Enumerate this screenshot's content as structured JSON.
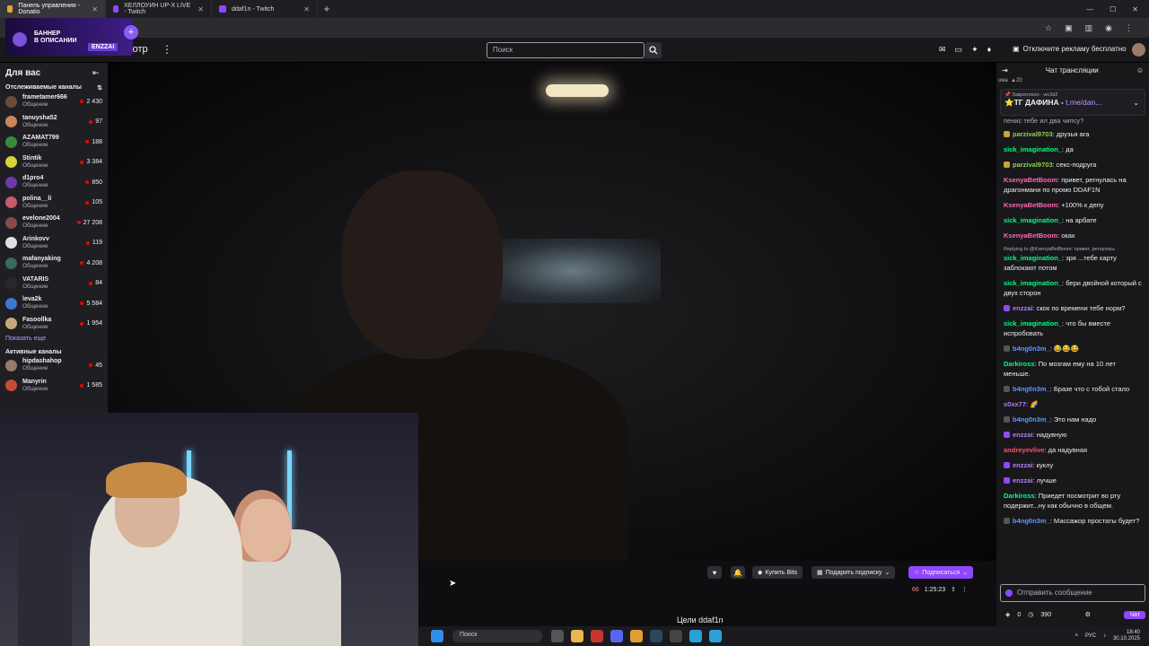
{
  "browser": {
    "tabs": [
      {
        "label": "Панель управления - Donatio",
        "color": "#e6a33a",
        "active": true
      },
      {
        "label": "ХЕЛЛОУИН UP-X LIVE - Twitch",
        "color": "#9147ff",
        "active": false
      },
      {
        "label": "ddaf1n - Twitch",
        "color": "#9147ff",
        "active": false
      }
    ],
    "new_tab": "+"
  },
  "banner": {
    "line1": "БАННЕР",
    "line2": "В ОПИСАНИИ",
    "tag": "ENZZAI"
  },
  "topnav": {
    "browse": "мотр",
    "search_placeholder": "Поиск",
    "adfree": "Отключите рекламу бесплатно"
  },
  "sidebar": {
    "title": "Для вас",
    "followed_title": "Отслеживаемые каналы",
    "followed": [
      {
        "name": "frametamer666",
        "game": "Общение",
        "viewers": "2 430",
        "color": "#6b4a3a"
      },
      {
        "name": "tanuysha52",
        "game": "Общение",
        "viewers": "97",
        "color": "#c8865a"
      },
      {
        "name": "AZAMAT799",
        "game": "Общение",
        "viewers": "188",
        "color": "#3a8a3a"
      },
      {
        "name": "Stintik",
        "game": "Общение",
        "viewers": "3 384",
        "color": "#d8d23a"
      },
      {
        "name": "d1pro4",
        "game": "Общение",
        "viewers": "850",
        "color": "#6a3aa8"
      },
      {
        "name": "polina__li",
        "game": "Общение",
        "viewers": "105",
        "color": "#c85a6a"
      },
      {
        "name": "evelone2004",
        "game": "Общение",
        "viewers": "27 208",
        "color": "#8a4a4a"
      },
      {
        "name": "Arinkovv",
        "game": "Общение",
        "viewers": "119",
        "color": "#e0e0e0"
      },
      {
        "name": "mafanyaking",
        "game": "Общение",
        "viewers": "4 208",
        "color": "#3a6a5a"
      },
      {
        "name": "VATARIS",
        "game": "Общение",
        "viewers": "84",
        "color": "#2a2a2a"
      },
      {
        "name": "leva2k",
        "game": "Общение",
        "viewers": "5 584",
        "color": "#3a7ac8"
      },
      {
        "name": "Fasoollka",
        "game": "Общение",
        "viewers": "1 954",
        "color": "#c8a87a"
      }
    ],
    "show_more": "Показать еще",
    "active_title": "Активные каналы",
    "active": [
      {
        "name": "hipdashahop",
        "game": "Общение",
        "viewers": "45",
        "color": "#9a7a6a"
      },
      {
        "name": "Manyrin",
        "game": "Общение",
        "viewers": "1 585",
        "color": "#c84a3a"
      }
    ]
  },
  "player": {
    "buy_bits": "Купить Bits",
    "gift_sub": "Подарить подписку",
    "subscribe": "Подписаться",
    "viewers": "66",
    "uptime": "1:25:23",
    "goals": "Цели ddaf1n"
  },
  "chat": {
    "title": "Чат трансляции",
    "sub_label": "ома",
    "sub_count": "20",
    "pinned_label": "Закреплено",
    "pinned_by": "wc3d2",
    "pinned_text": "ТГ ДАФИНА - ",
    "pinned_link": "t.me/dan...",
    "top_fragment": "пенис тебе ил два чипсу?",
    "messages": [
      {
        "user": "parzival9703",
        "color": "#8bd24a",
        "text": "друзья ага",
        "badge": "#c8a23a"
      },
      {
        "user": "sick_imagination_",
        "color": "#00ff7f",
        "text": "да",
        "badge": ""
      },
      {
        "user": "parzival9703",
        "color": "#8bd24a",
        "text": "секс-подруга",
        "badge": "#c8a23a"
      },
      {
        "user": "KsenyaBetBoom",
        "color": "#ff69b4",
        "text": "привет, регнулась на драгонмани по промо DDAF1N",
        "badge": ""
      },
      {
        "user": "KsenyaBetBoom",
        "color": "#ff69b4",
        "text": "+100% к депу",
        "badge": ""
      },
      {
        "user": "sick_imagination_",
        "color": "#00ff7f",
        "text": "на арбате",
        "badge": ""
      },
      {
        "user": "KsenyaBetBoom",
        "color": "#ff69b4",
        "text": "окак",
        "badge": ""
      },
      {
        "reply": "Replying to @KsenyaBetBoom: привет, регнулась",
        "user": "sick_imagination_",
        "color": "#00ff7f",
        "text": "зря ...тебе карту заблокают потом",
        "badge": ""
      },
      {
        "user": "sick_imagination_",
        "color": "#00ff7f",
        "text": "бери двойной который с двух сторон",
        "badge": ""
      },
      {
        "user": "enzzai",
        "color": "#b07cff",
        "text": "скок по времени тебе норм?",
        "badge": "#9147ff"
      },
      {
        "user": "sick_imagination_",
        "color": "#00ff7f",
        "text": "что бы вместе испробовать",
        "badge": ""
      },
      {
        "user": "b4ng0n3m_",
        "color": "#5a9bff",
        "text": "😂😂😂",
        "badge": "#555"
      },
      {
        "user": "Darkiross",
        "color": "#00ff7f",
        "text": "По мозгам ему на 10 лет меньше.",
        "badge": ""
      },
      {
        "user": "b4ng0n3m_",
        "color": "#5a9bff",
        "text": "Бразе что с тобой стало",
        "badge": "#555"
      },
      {
        "user": "s0xx77",
        "color": "#b07cff",
        "text": "🌈",
        "badge": ""
      },
      {
        "user": "b4ng0n3m_",
        "color": "#5a9bff",
        "text": "Это нам надо",
        "badge": "#555"
      },
      {
        "user": "enzzai",
        "color": "#b07cff",
        "text": "надувную",
        "badge": "#9147ff"
      },
      {
        "user": "andreyevlive",
        "color": "#ff4f6e",
        "text": "да надувная",
        "badge": ""
      },
      {
        "user": "enzzai",
        "color": "#b07cff",
        "text": "куклу",
        "badge": "#9147ff"
      },
      {
        "user": "enzzai",
        "color": "#b07cff",
        "text": "лучше",
        "badge": "#9147ff"
      },
      {
        "user": "Darkiross",
        "color": "#00ff7f",
        "text": "Приедет посмотрит во рту подержит...ну как обычно в общем.",
        "badge": ""
      },
      {
        "user": "b4ng0n3m_",
        "color": "#5a9bff",
        "text": "Массажор простаты будет?",
        "badge": "#555"
      }
    ],
    "input_placeholder": "Отправить сообщение",
    "points": "0",
    "points2": "390",
    "chat_button": "Чат"
  },
  "taskbar": {
    "search": "Поиск",
    "lang": "РУС",
    "time": "18:40",
    "date": "30.10.2025"
  }
}
